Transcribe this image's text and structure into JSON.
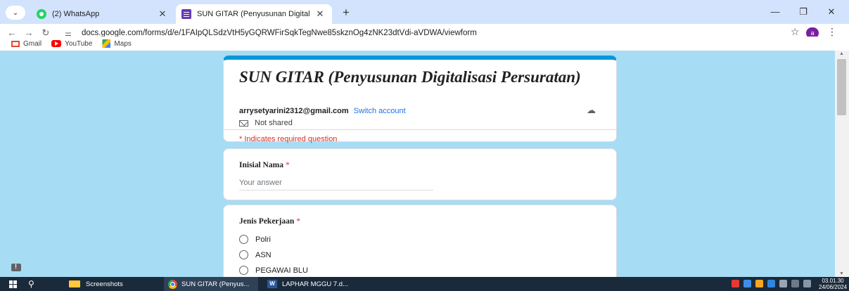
{
  "browser": {
    "tabs": [
      {
        "title": "(2) WhatsApp",
        "icon": "whatsapp-icon"
      },
      {
        "title": "SUN GITAR (Penyusunan Digital",
        "icon": "google-forms-icon",
        "active": true
      }
    ],
    "new_tab": "+",
    "close_glyph": "✕",
    "window_controls": {
      "minimize": "—",
      "restore": "❐",
      "close": "✕"
    },
    "url": "docs.google.com/forms/d/e/1FAIpQLSdzVtH5yGQRWFirSqkTegNwe85skznOg4zNK23dtVdi-aVDWA/viewform",
    "profile_initial": "a",
    "bookmarks": [
      {
        "label": "Gmail",
        "icon": "gmail-icon"
      },
      {
        "label": "YouTube",
        "icon": "youtube-icon"
      },
      {
        "label": "Maps",
        "icon": "maps-icon"
      }
    ]
  },
  "form": {
    "title": "SUN GITAR (Penyusunan Digitalisasi Persuratan)",
    "account_email": "arrysetyarini2312@gmail.com",
    "switch_account": "Switch account",
    "not_shared": "Not shared",
    "required_note": "* Indicates required question",
    "questions": [
      {
        "label": "Inisial Nama",
        "required_mark": "*",
        "placeholder": "Your answer"
      },
      {
        "label": "Jenis Pekerjaan",
        "required_mark": "*",
        "options": [
          "Polri",
          "ASN",
          "PEGAWAI BLU"
        ]
      }
    ]
  },
  "taskbar": {
    "items": [
      {
        "label": "Screenshots",
        "icon": "folder-icon"
      },
      {
        "label": "SUN GITAR (Penyus...",
        "icon": "chrome-icon"
      },
      {
        "label": "LAPHAR MGGU 7.d...",
        "icon": "word-icon"
      }
    ],
    "time": "03.01.30",
    "date": "24/06/2024"
  },
  "colors": {
    "page_background": "#a7dcf5",
    "form_accent": "#0797d9",
    "required": "#d93025",
    "link": "#1a73e8"
  }
}
